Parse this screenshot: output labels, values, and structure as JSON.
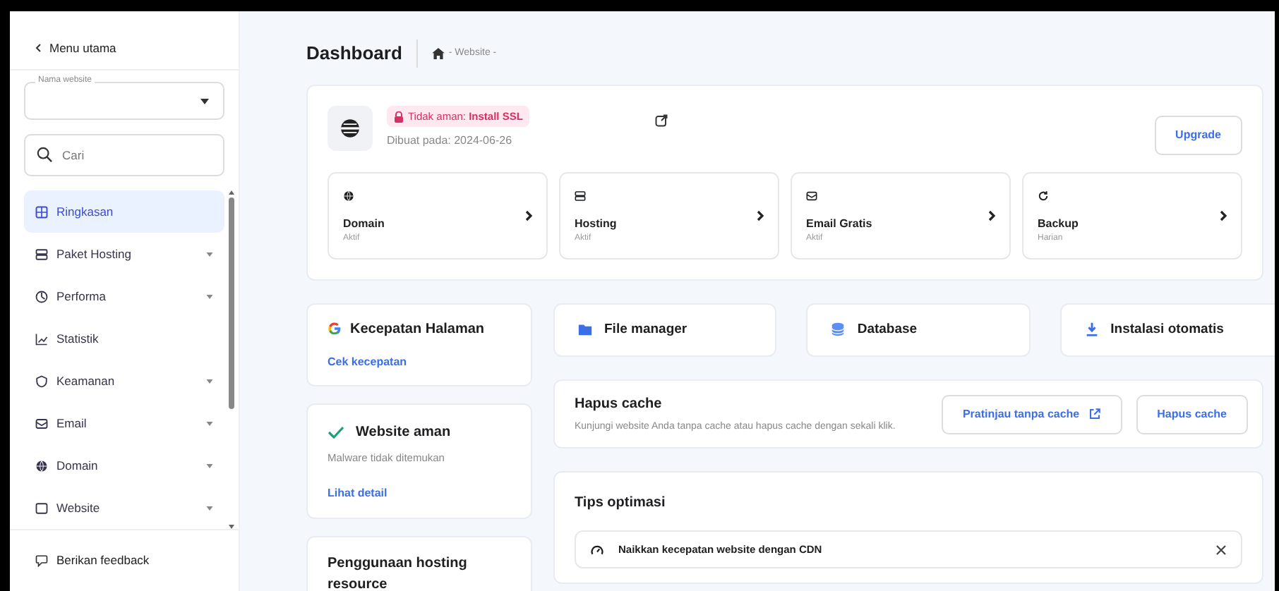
{
  "sidebar": {
    "back": "Menu utama",
    "website_select": {
      "label": "Nama website"
    },
    "search": {
      "placeholder": "Cari"
    },
    "items": [
      {
        "label": "Ringkasan",
        "selected": true,
        "expandable": false
      },
      {
        "label": "Paket Hosting",
        "selected": false,
        "expandable": true
      },
      {
        "label": "Performa",
        "selected": false,
        "expandable": true
      },
      {
        "label": "Statistik",
        "selected": false,
        "expandable": false
      },
      {
        "label": "Keamanan",
        "selected": false,
        "expandable": true
      },
      {
        "label": "Email",
        "selected": false,
        "expandable": true
      },
      {
        "label": "Domain",
        "selected": false,
        "expandable": true
      },
      {
        "label": "Website",
        "selected": false,
        "expandable": true
      }
    ],
    "feedback": "Berikan feedback"
  },
  "header": {
    "title": "Dashboard",
    "breadcrumb": "- Website -"
  },
  "site_card": {
    "badge": "Tidak aman: **Install SSL**",
    "created": "Dibuat pada: 2024-06-26",
    "upgrade": "Upgrade",
    "services": [
      {
        "name": "Domain",
        "status": "Aktif"
      },
      {
        "name": "Hosting",
        "status": "Aktif"
      },
      {
        "name": "Email Gratis",
        "status": "Aktif"
      },
      {
        "name": "Backup",
        "status": "Harian"
      }
    ]
  },
  "speed_card": {
    "title": "Kecepatan Halaman",
    "link": "Cek kecepatan"
  },
  "security_card": {
    "title": "Website aman",
    "subtitle": "Malware tidak ditemukan",
    "link": "Lihat detail"
  },
  "usage_card": {
    "title": "Penggunaan hosting resource"
  },
  "shortcuts": [
    {
      "label": "File manager"
    },
    {
      "label": "Database"
    },
    {
      "label": "Instalasi otomatis"
    }
  ],
  "cache_card": {
    "title": "Hapus cache",
    "description": "Kunjungi website Anda tanpa cache atau hapus cache dengan sekali klik.",
    "buttons": [
      {
        "label": "Pratinjau tanpa cache",
        "external": true
      },
      {
        "label": "Hapus cache",
        "external": false
      }
    ]
  },
  "tips": {
    "title": "Tips optimasi",
    "items": [
      {
        "text": "Naikkan kecepatan website dengan CDN"
      }
    ]
  }
}
